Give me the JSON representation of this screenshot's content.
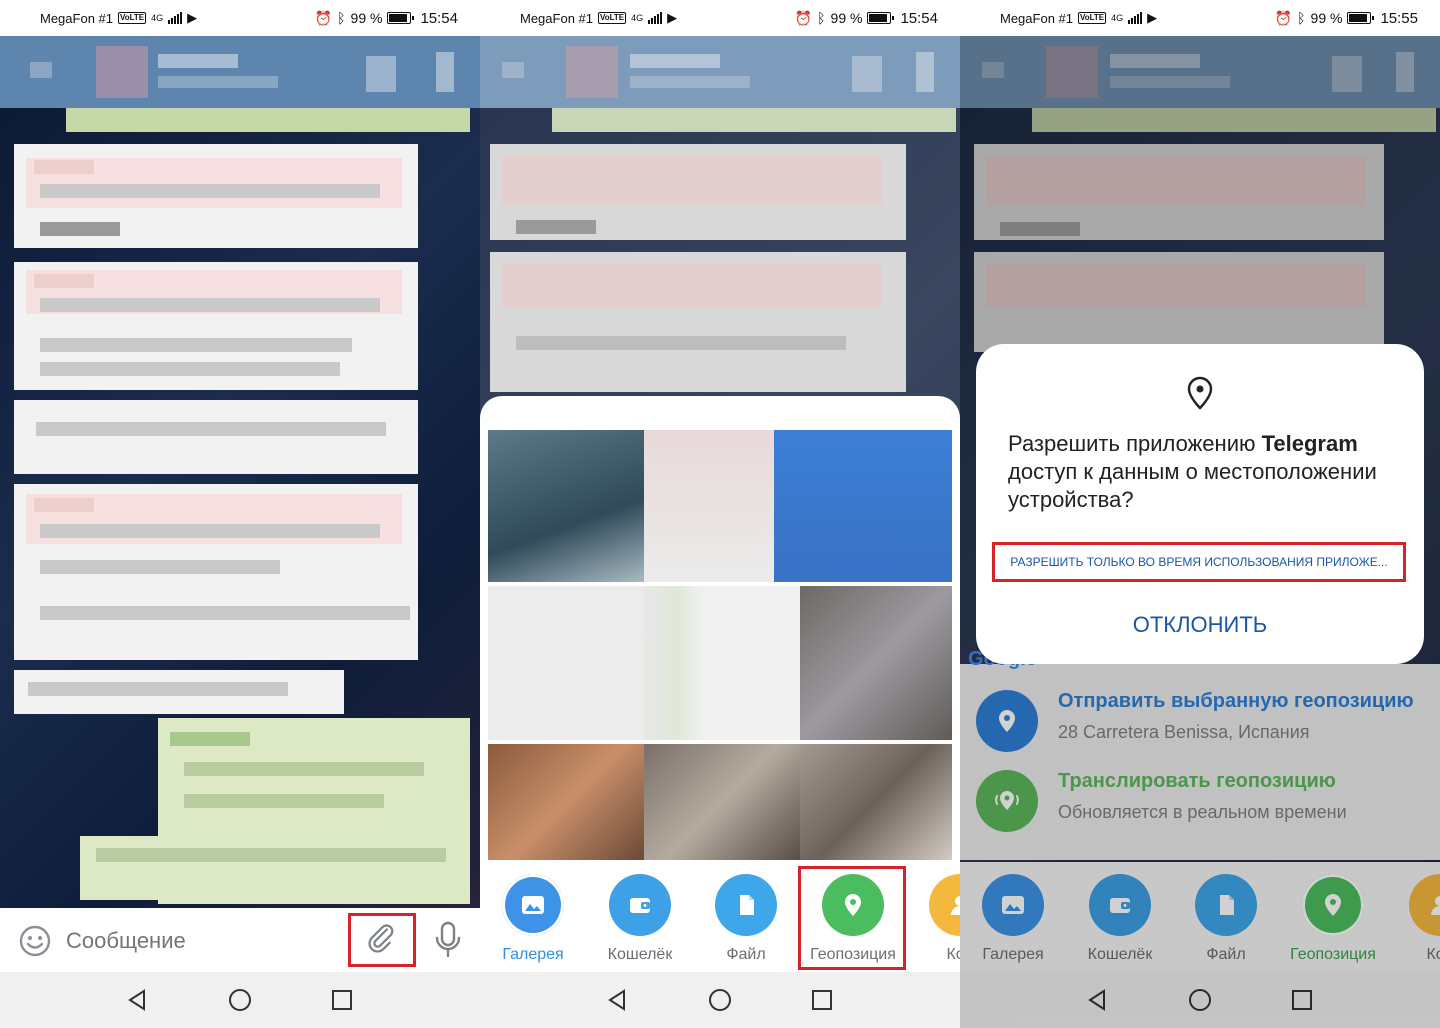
{
  "status_bar": [
    {
      "carrier": "MegaFon #1",
      "volte": "VoLTE",
      "network": "4G",
      "battery": "99 %",
      "time": "15:54"
    },
    {
      "carrier": "MegaFon #1",
      "volte": "VoLTE",
      "network": "4G",
      "battery": "99 %",
      "time": "15:54"
    },
    {
      "carrier": "MegaFon #1",
      "volte": "VoLTE",
      "network": "4G",
      "battery": "99 %",
      "time": "15:55"
    }
  ],
  "composer": {
    "placeholder": "Сообщение"
  },
  "attach_menu": [
    {
      "label": "Галерея",
      "icon": "gallery-icon",
      "color": "#3e93e6"
    },
    {
      "label": "Кошелёк",
      "icon": "wallet-icon",
      "color": "#3ea0e6"
    },
    {
      "label": "Файл",
      "icon": "file-icon",
      "color": "#3ea7ea"
    },
    {
      "label": "Геопозиция",
      "icon": "location-pin-icon",
      "color": "#4cbd5f"
    },
    {
      "label": "Кон",
      "icon": "contact-icon",
      "color": "#f4b83e"
    }
  ],
  "attach_menu_dim": [
    {
      "label": "Галерея"
    },
    {
      "label": "Кошелёк"
    },
    {
      "label": "Файл"
    },
    {
      "label": "Геопозиция"
    },
    {
      "label": "Кон"
    }
  ],
  "permission_dialog": {
    "title_prefix": "Разрешить приложению ",
    "app_name": "Telegram",
    "title_suffix": "доступ к данным о местоположении устройства?",
    "allow_button": "РАЗРЕШИТЬ ТОЛЬКО ВО ВРЕМЯ ИСПОЛЬЗОВАНИЯ ПРИЛОЖЕ...",
    "deny_button": "ОТКЛОНИТЬ"
  },
  "location_options": [
    {
      "title": "Отправить выбранную геопозицию",
      "subtitle": "28 Carretera Benissa, Испания",
      "color": "#2f7fd6"
    },
    {
      "title": "Транслировать геопозицию",
      "subtitle": "Обновляется в реальном времени",
      "color": "#5cb85c"
    }
  ],
  "google_logo": "Google",
  "colors": {
    "highlight": "#d7222a",
    "accent_blue": "#1a56a8",
    "telegram_blue": "#2f8fe0"
  }
}
